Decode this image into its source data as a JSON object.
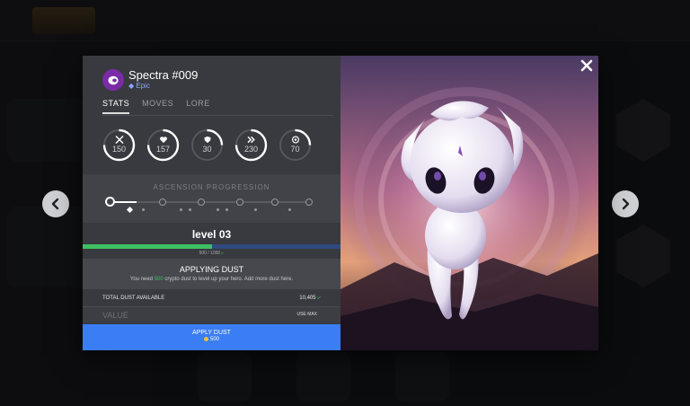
{
  "hero": {
    "name": "Spectra #009",
    "rarity": "Epic"
  },
  "tabs": [
    {
      "label": "STATS",
      "active": true
    },
    {
      "label": "MOVES",
      "active": false
    },
    {
      "label": "LORE",
      "active": false
    }
  ],
  "stats": [
    {
      "icon": "swords-icon",
      "value": "150"
    },
    {
      "icon": "heart-icon",
      "value": "157"
    },
    {
      "icon": "shield-icon",
      "value": "30"
    },
    {
      "icon": "speed-icon",
      "value": "230"
    },
    {
      "icon": "target-icon",
      "value": "70"
    }
  ],
  "ascension": {
    "title": "ASCENSION PROGRESSION"
  },
  "level": {
    "label": "level 03",
    "progress_text": "500 / 1000",
    "progress_fraction": 0.5
  },
  "applying": {
    "title": "APPLYING DUST",
    "desc_before": "You need ",
    "desc_amount": "500",
    "desc_after": " crypto dust to level up your hero. Add more dust here."
  },
  "total": {
    "label": "TOTAL DUST AVAILABLE",
    "value": "10,405"
  },
  "value_input": {
    "placeholder": "VALUE",
    "use_max": "USE MAX"
  },
  "apply_button": {
    "label": "APPLY DUST",
    "cost": "500"
  },
  "colors": {
    "accent_blue": "#3b7df4",
    "dust_green": "#3fbf63",
    "epic_purple": "#7a2ba6"
  }
}
